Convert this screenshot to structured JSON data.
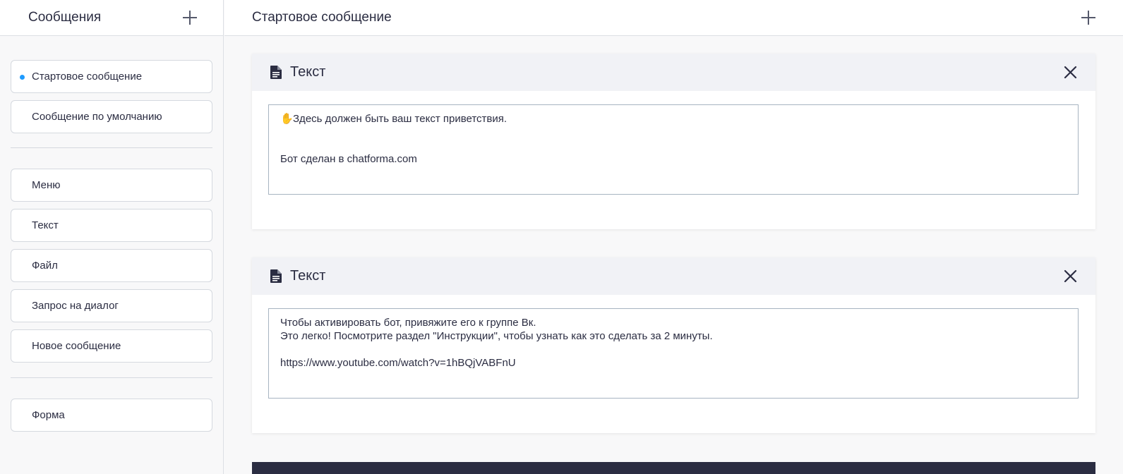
{
  "sidebar": {
    "title": "Сообщения",
    "add_icon": "plus-icon",
    "group1": [
      {
        "label": "Стартовое сообщение",
        "active": true
      },
      {
        "label": "Сообщение по умолчанию",
        "active": false
      }
    ],
    "group2": [
      {
        "label": "Меню"
      },
      {
        "label": "Текст"
      },
      {
        "label": "Файл"
      },
      {
        "label": "Запрос на диалог"
      },
      {
        "label": "Новое сообщение"
      }
    ],
    "group3": [
      {
        "label": "Форма"
      }
    ],
    "active_dot_color": "#1e9bff"
  },
  "main": {
    "title": "Стартовое сообщение",
    "add_icon": "plus-icon",
    "cards": [
      {
        "title": "Текст",
        "icon": "document-icon",
        "close_icon": "close-icon",
        "emoji": "✋",
        "text": "Здесь должен быть ваш текст приветствия.\n\n\nБот сделан в chatforma.com"
      },
      {
        "title": "Текст",
        "icon": "document-icon",
        "close_icon": "close-icon",
        "text": "Чтобы активировать бот, привяжите его к группе Вк.\nЭто легко! Посмотрите раздел \"Инструкции\", чтобы узнать как это сделать за 2 минуты.\n\nhttps://www.youtube.com/watch?v=1hBQjVABFnU"
      }
    ]
  }
}
